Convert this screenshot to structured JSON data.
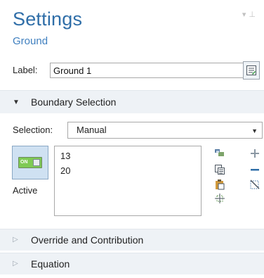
{
  "header": {
    "title": "Settings",
    "subtitle": "Ground"
  },
  "label_field": {
    "label": "Label:",
    "value": "Ground 1"
  },
  "sections": {
    "boundary_selection": "Boundary Selection",
    "override": "Override and Contribution",
    "equation": "Equation"
  },
  "selection": {
    "label": "Selection:",
    "value": "Manual",
    "items": [
      "13",
      "20"
    ]
  },
  "active": {
    "toggle_text": "ON",
    "label": "Active"
  },
  "colors": {
    "title": "#2f6ea8",
    "section_bg": "#eef2f6",
    "toggle_green": "#7fca54"
  },
  "icons": {
    "label_button": "edit-label-icon",
    "tools": [
      "paste-selection-icon",
      "copy-selection-icon",
      "clipboard-icon",
      "zoom-to-selection-icon",
      "add-icon",
      "remove-icon",
      "clear-selection-icon"
    ]
  }
}
